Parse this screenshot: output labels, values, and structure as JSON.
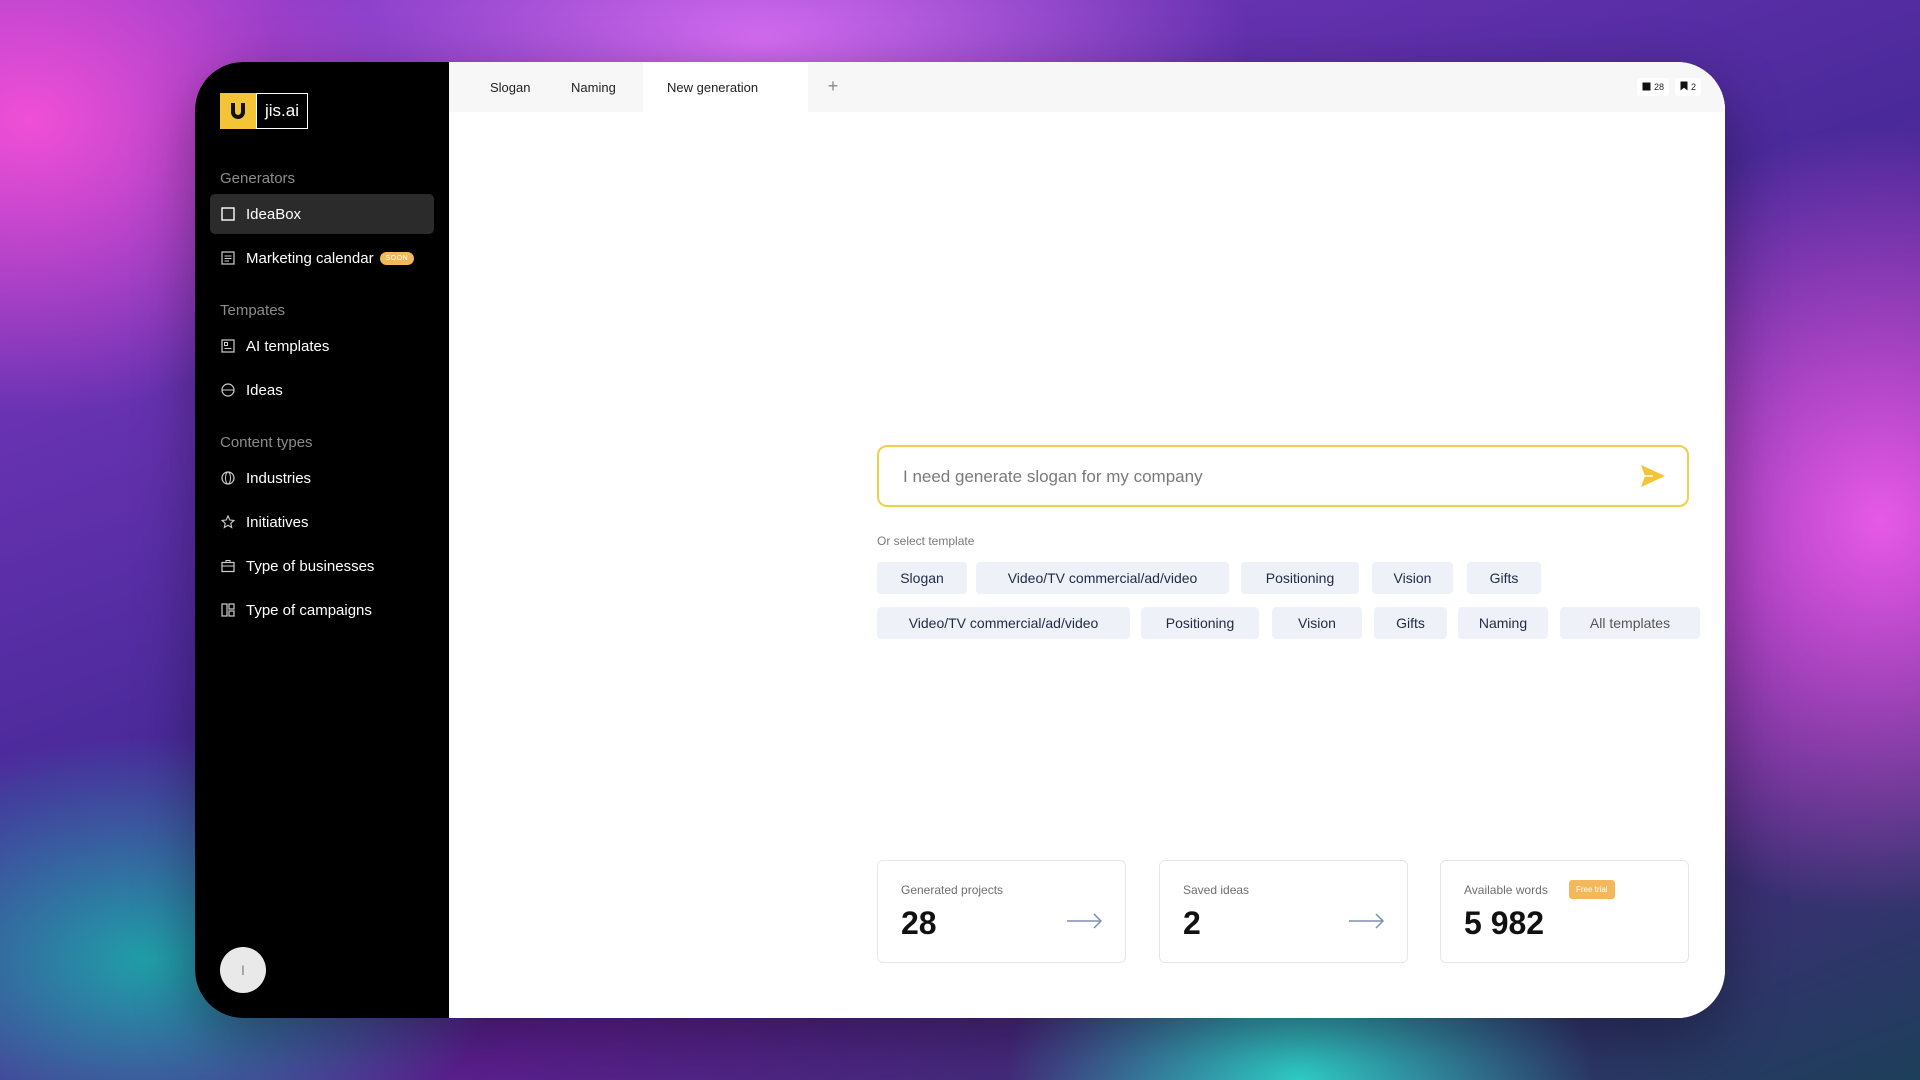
{
  "brand": {
    "name": "jis.ai",
    "logo_icon": "horseshoe-icon",
    "accent_color": "#f3c536"
  },
  "sidebar": {
    "generators_label": "Generators",
    "generators": [
      {
        "label": "IdeaBox",
        "icon": "square-icon",
        "active": true
      },
      {
        "label": "Marketing calendar",
        "icon": "calendar-list-icon",
        "badge": "SOON"
      }
    ],
    "templates_label": "Tempates",
    "templates": [
      {
        "label": "AI templates",
        "icon": "template-icon"
      },
      {
        "label": "Ideas",
        "icon": "ideas-icon"
      }
    ],
    "content_types_label": "Content types",
    "content_types": [
      {
        "label": "Industries",
        "icon": "globe-icon"
      },
      {
        "label": "Initiatives",
        "icon": "star-icon"
      },
      {
        "label": "Type of businesses",
        "icon": "briefcase-icon"
      },
      {
        "label": "Type of campaigns",
        "icon": "layout-icon"
      }
    ],
    "avatar_initial": "I"
  },
  "tabs": [
    {
      "label": "Slogan"
    },
    {
      "label": "Naming"
    },
    {
      "label": "New generation",
      "active": true
    }
  ],
  "counters": {
    "generated": "28",
    "saved": "2"
  },
  "prompt": {
    "placeholder": "I need generate slogan for my company",
    "value": ""
  },
  "templates_section": {
    "label": "Or select template",
    "row1": [
      "Slogan",
      "Video/TV commercial/ad/video",
      "Positioning",
      "Vision",
      "Gifts"
    ],
    "row2": [
      "Video/TV commercial/ad/video",
      "Positioning",
      "Vision",
      "Gifts",
      "Naming"
    ],
    "all_templates": "All templates"
  },
  "stats": {
    "generated_projects": {
      "label": "Generated projects",
      "value": "28"
    },
    "saved_ideas": {
      "label": "Saved ideas",
      "value": "2"
    },
    "available_words": {
      "label": "Available words",
      "value": "5 982",
      "badge": "Free trial"
    }
  }
}
